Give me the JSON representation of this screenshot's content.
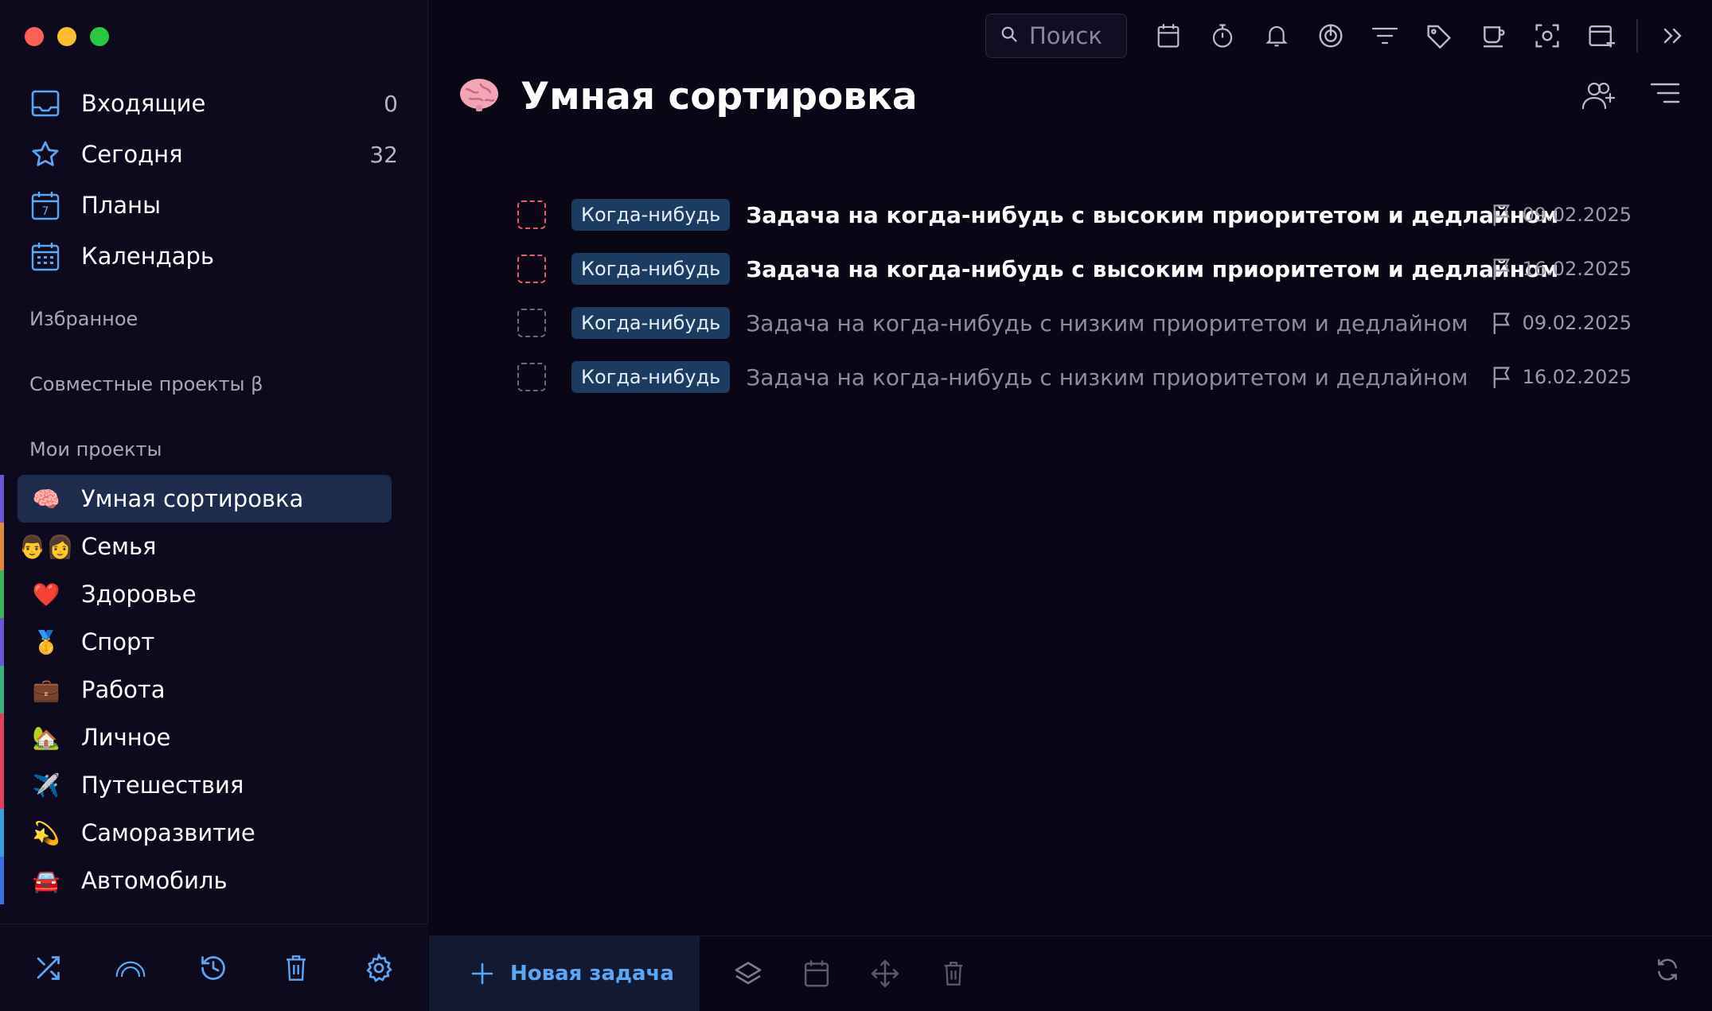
{
  "sidebar": {
    "nav": [
      {
        "label": "Входящие",
        "count": "0",
        "icon": "inbox-icon"
      },
      {
        "label": "Сегодня",
        "count": "32",
        "icon": "star-icon"
      },
      {
        "label": "Планы",
        "count": "",
        "icon": "calendar-7-icon"
      },
      {
        "label": "Календарь",
        "count": "",
        "icon": "calendar-grid-icon"
      }
    ],
    "sections": {
      "favorites": "Избранное",
      "shared": "Совместные проекты β",
      "my_projects": "Мои проекты"
    },
    "projects": [
      {
        "label": "Умная сортировка",
        "emoji": "🧠",
        "color": "#6b57d6",
        "active": true
      },
      {
        "label": "Семья",
        "emoji": "👨‍👩",
        "color": "#e08a3c"
      },
      {
        "label": "Здоровье",
        "emoji": "❤️",
        "color": "#3bb25a"
      },
      {
        "label": "Спорт",
        "emoji": "🥇",
        "color": "#6b57d6"
      },
      {
        "label": "Работа",
        "emoji": "💼",
        "color": "#3bb27d"
      },
      {
        "label": "Личное",
        "emoji": "🏡",
        "color": "#e2415b"
      },
      {
        "label": "Путешествия",
        "emoji": "✈️",
        "color": "#e2415b"
      },
      {
        "label": "Саморазвитие",
        "emoji": "💫",
        "color": "#3b9fe2"
      },
      {
        "label": "Автомобиль",
        "emoji": "🚘",
        "color": "#3b6fe2"
      }
    ]
  },
  "toolbar": {
    "search_placeholder": "Поиск"
  },
  "main": {
    "title": "Умная сортировка",
    "title_emoji": "🧠",
    "tasks": [
      {
        "tag": "Когда-нибудь",
        "title": "Задача на когда-нибудь с высоким приоритетом и дедлайном",
        "due": "09.02.2025",
        "priority": "high"
      },
      {
        "tag": "Когда-нибудь",
        "title": "Задача на когда-нибудь с высоким приоритетом и дедлайном",
        "due": "16.02.2025",
        "priority": "high"
      },
      {
        "tag": "Когда-нибудь",
        "title": "Задача на когда-нибудь с низким приоритетом и дедлайном",
        "due": "09.02.2025",
        "priority": "low"
      },
      {
        "tag": "Когда-нибудь",
        "title": "Задача на когда-нибудь с низким приоритетом и дедлайном",
        "due": "16.02.2025",
        "priority": "low"
      }
    ]
  },
  "bottom": {
    "new_task_label": "Новая задача"
  },
  "colors": {
    "accent_blue": "#5aa8f5",
    "priority_high": "#e25c64",
    "tag_bg": "#1b3c60",
    "active_bg": "#1d2c4d"
  }
}
